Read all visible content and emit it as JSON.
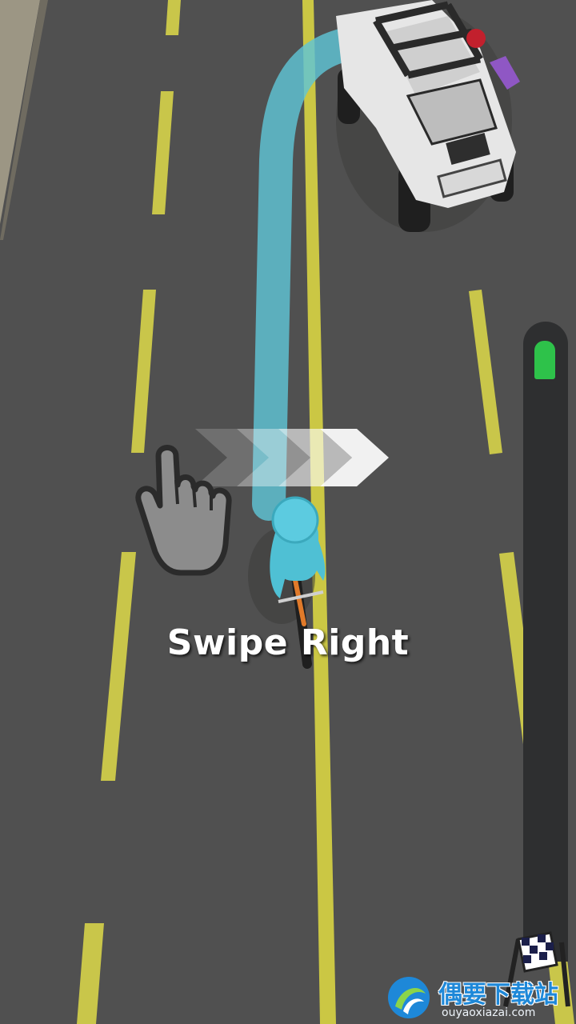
{
  "tutorial": {
    "instruction": "Swipe Right",
    "gesture_icon": "pointing-hand-icon",
    "direction_icon": "chevrons-right-icon"
  },
  "progress": {
    "value": 0.0,
    "marker_color": "#2ec24a"
  },
  "finish_icon": "checkered-flag-icon",
  "path_color": "#5fc4d6",
  "player_color": "#4fc0d4",
  "watermark": {
    "name": "偶要下载站",
    "url": "ouyaoxiazai.com"
  }
}
